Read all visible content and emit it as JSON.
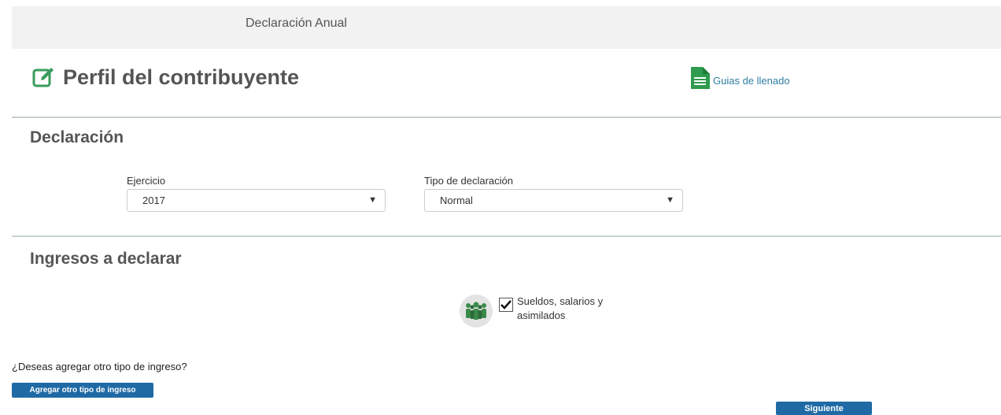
{
  "header": {
    "title": "Declaración Anual"
  },
  "page": {
    "title": "Perfil del contribuyente"
  },
  "guides": {
    "label": "Guias de llenado"
  },
  "declaration": {
    "title": "Declaración",
    "ejercicio": {
      "label": "Ejercicio",
      "value": "2017"
    },
    "tipo": {
      "label": "Tipo de declaración",
      "value": "Normal"
    }
  },
  "income": {
    "title": "Ingresos a declarar",
    "items": [
      {
        "label_line1": "Sueldos, salarios y",
        "label_line2": "asimilados",
        "checked": true
      }
    ],
    "question": "¿Deseas agregar otro tipo de ingreso?",
    "add_button": "Agregar otro tipo de ingreso"
  },
  "next_button": "Siguiente",
  "colors": {
    "accent_green": "#3a9b5c",
    "link_blue": "#2f7da3",
    "button_blue": "#1f6aa5"
  }
}
